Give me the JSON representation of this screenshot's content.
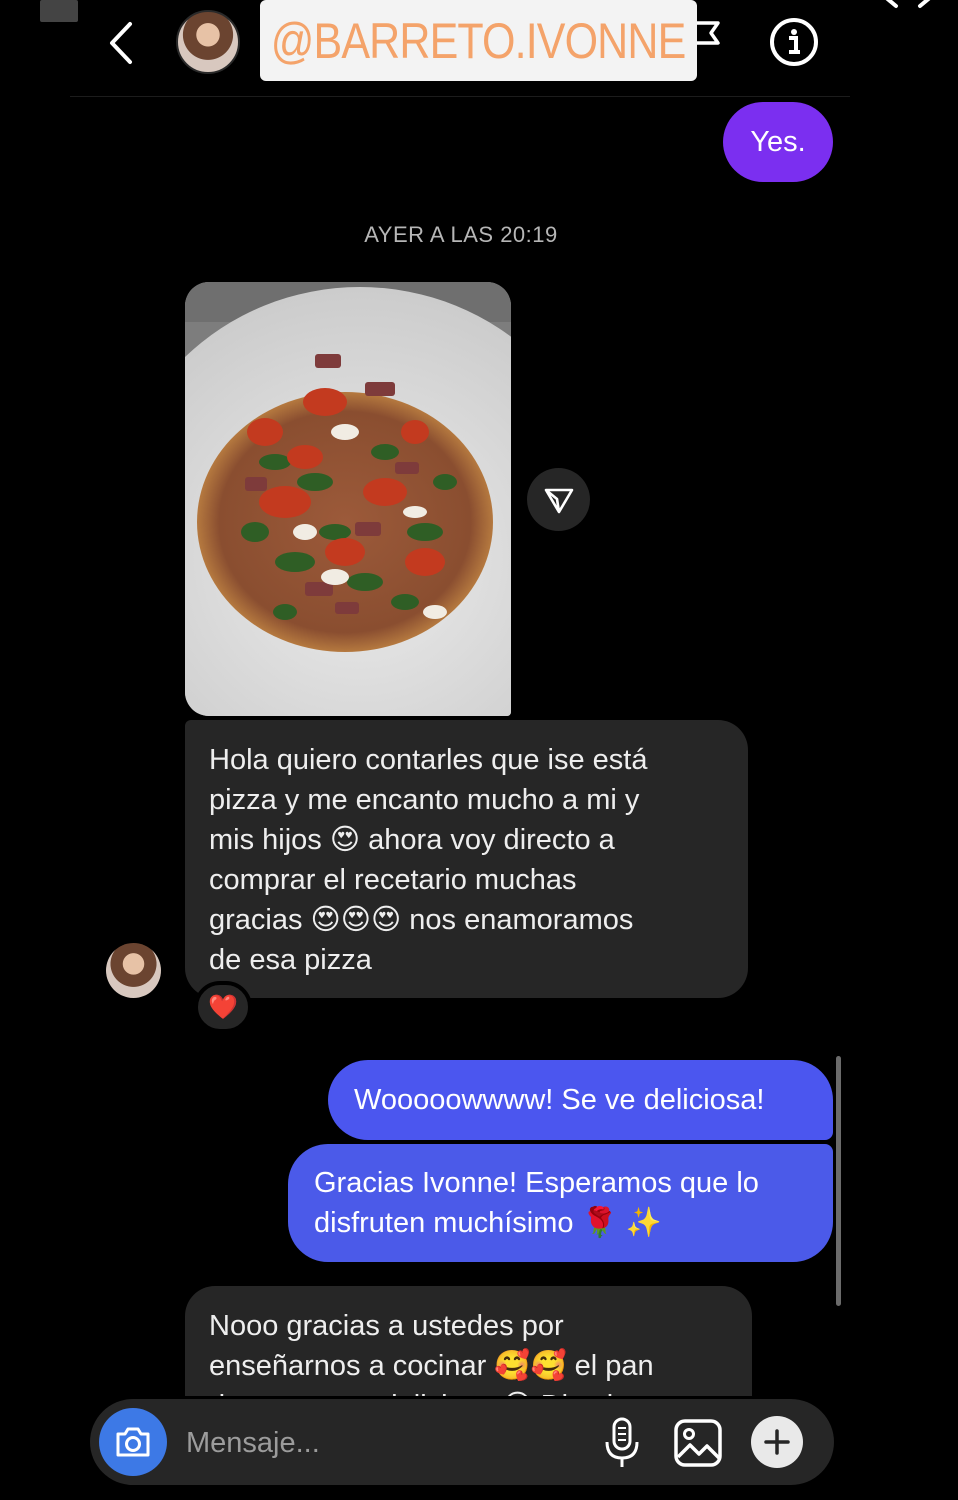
{
  "header": {
    "username": "@BARRETO.IVONNE",
    "icons": [
      "back-icon",
      "avatar",
      "flag-icon",
      "info-icon",
      "close-icon"
    ]
  },
  "messages": {
    "outgoing_yes": "Yes.",
    "timestamp": "AYER A LAS 20:19",
    "incoming_1_lines": [
      "Hola quiero contarles que ise está",
      "pizza y me encanto mucho a mi y",
      "mis hijos 😍 ahora voy directo a",
      "comprar el recetario muchas",
      "gracias 😍😍😍 nos enamoramos",
      "de esa pizza"
    ],
    "reaction": "❤️",
    "outgoing_2": "Wooooowwww! Se ve deliciosa!",
    "outgoing_3_lines": [
      "Gracias Ivonne! Esperamos que lo",
      "disfruten muchísimo 🌹 ✨"
    ],
    "incoming_2_lines": [
      "Nooo gracias a ustedes por",
      "enseñarnos a cocinar 🥰🥰 el pan",
      "de coco esta delicioso 😋 Dios le"
    ]
  },
  "composer": {
    "placeholder": "Mensaje..."
  },
  "colors": {
    "background": "#000000",
    "incoming_bubble": "#262626",
    "outgoing_purple": "#7b2ff0",
    "outgoing_blue": "#4b56ef",
    "camera_button": "#3d79e6",
    "username_text": "#f4a36a"
  }
}
